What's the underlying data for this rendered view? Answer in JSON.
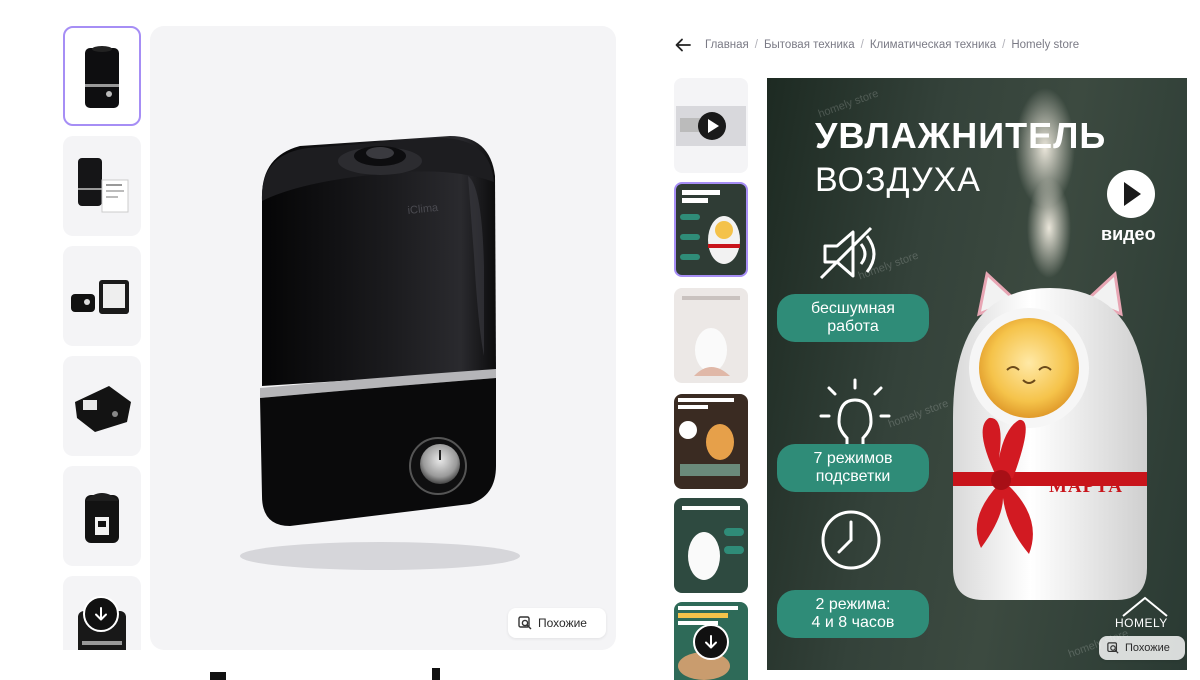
{
  "similar_label": "Похожие",
  "breadcrumb": {
    "items": [
      "Главная",
      "Бытовая техника",
      "Климатическая техника",
      "Homely store"
    ],
    "separator": "/"
  },
  "product_image": {
    "brand_text": "iClima"
  },
  "hero": {
    "title_line1": "УВЛАЖНИТЕЛЬ",
    "title_line2": "ВОЗДУХА",
    "video_label": "видео",
    "features": [
      {
        "line1": "бесшумная",
        "line2": "работа"
      },
      {
        "line1": "7 режимов",
        "line2": "подсветки"
      },
      {
        "line1": "2 режима:",
        "line2": "4 и 8 часов"
      }
    ],
    "ribbon_text": "МАРТА",
    "logo_text": "HOMELY",
    "watermark_text": "homely store"
  },
  "colors": {
    "accent_border": "#a68ef5",
    "pill_green": "#2f8c78",
    "ribbon_red": "#c8141b",
    "thumb_bg": "#f4f4f6"
  },
  "icons": [
    "arrow-left-icon",
    "arrow-down-icon",
    "similar-search-icon",
    "play-icon",
    "mute-icon",
    "bulb-icon",
    "clock-icon"
  ]
}
